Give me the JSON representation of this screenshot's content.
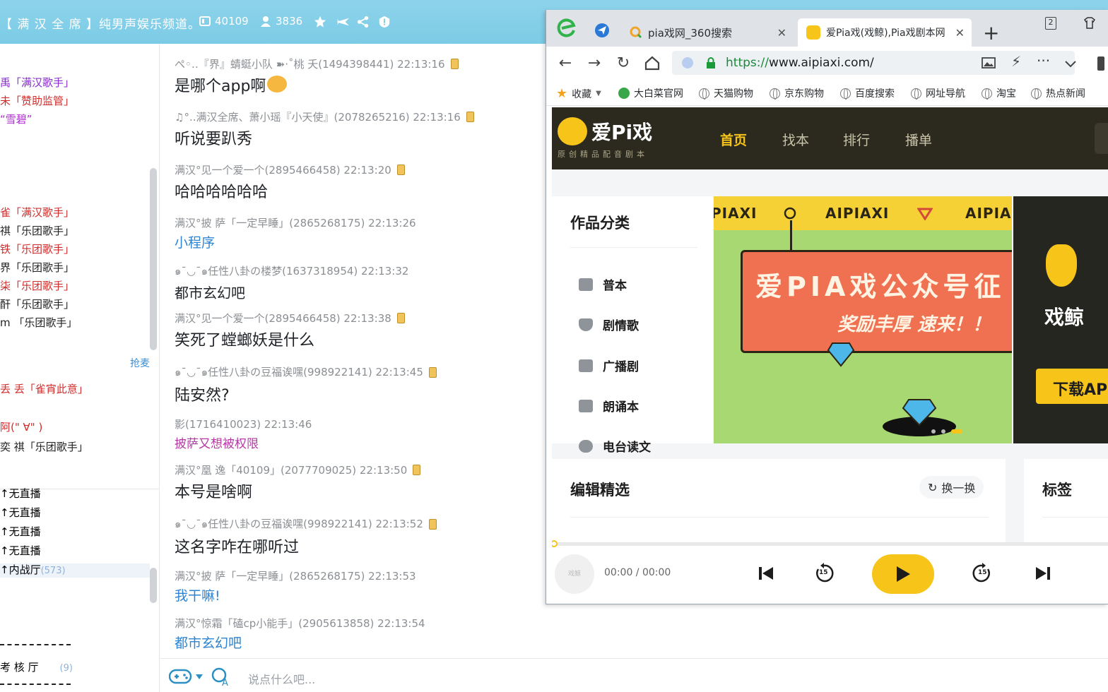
{
  "chat": {
    "title": "【 满 汉 全 席 】纯男声娱乐频道。",
    "room_id": "40109",
    "online_count": "3836",
    "input_placeholder": "说点什么吧...",
    "grab_mic": "抢麦",
    "left_rows_top": [
      {
        "text": "禹「满汉歌手」",
        "color": "#8a2bd1"
      },
      {
        "text": "未「赞助监管」",
        "color": "#d12b2b"
      },
      {
        "text": "“雪碧”",
        "color": "#b02bd1"
      }
    ],
    "left_rows_mid": [
      {
        "text": "雀「满汉歌手」",
        "color": "#d12b2b"
      },
      {
        "text": "祺「乐团歌手」",
        "color": "#222222"
      },
      {
        "text": "铁「乐团歌手」",
        "color": "#d12b2b"
      },
      {
        "text": "界「乐团歌手」",
        "color": "#222222"
      },
      {
        "text": "柒「乐团歌手」",
        "color": "#d12b2b"
      },
      {
        "text": "酐「乐团歌手」",
        "color": "#222222"
      },
      {
        "text": "m 「乐团歌手」",
        "color": "#222222"
      }
    ],
    "left_rows_queue": [
      {
        "text": "丢   丢「雀宵此意」",
        "color": "#d12b2b"
      },
      {
        "text": "阿(\" ∀\" )",
        "color": "#d12b2b"
      },
      {
        "text": "奕   祺「乐团歌手」",
        "color": "#222222"
      }
    ],
    "left_rows_channels": [
      "无直播",
      "无直播",
      "无直播",
      "无直播"
    ],
    "inner_hall": {
      "label": "内战厅",
      "count": "(573)"
    },
    "assess_hall": {
      "label": "考 核 厅",
      "count": "(9)"
    },
    "messages": [
      {
        "meta": "ぺ◦‥『界』蜻蜓小队 ➽·˚桃    夭(1494398441)  22:13:16",
        "text": "是哪个app啊",
        "style": "normal",
        "emoji": true,
        "device": true
      },
      {
        "meta": "♫°..满汉全席、萧小瑶『小天使』(2078265216)  22:13:16",
        "text": "听说要趴秀",
        "style": "normal",
        "device": true
      },
      {
        "meta": "满汉°见一个爱一个(2895466458)  22:13:20",
        "text": "哈哈哈哈哈哈",
        "style": "normal",
        "device": true
      },
      {
        "meta": "满汉°披    萨「一定早睡」(2865268175)  22:13:26",
        "text": "小程序",
        "style": "link"
      },
      {
        "meta": "๑¯◡¯๑任性八卦の楼梦(1637318954)  22:13:32",
        "text": "都市玄幻吧",
        "style": "normal"
      },
      {
        "meta": "满汉°见一个爱一个(2895466458)  22:13:38",
        "text": "笑死了螳螂妖是什么",
        "style": "normal",
        "device": true
      },
      {
        "meta": "๑¯◡¯๑任性八卦の豆福诶嘿(998922141)  22:13:45",
        "text": "陆安然?",
        "style": "normal",
        "device": true
      },
      {
        "meta": "影(1716410023)  22:13:46",
        "text": "披萨又想被权限",
        "style": "magenta"
      },
      {
        "meta": "满汉°凰    逸「40109」(2077709025)  22:13:50",
        "text": "本号是啥啊",
        "style": "normal",
        "device": true
      },
      {
        "meta": "๑¯◡¯๑任性八卦の豆福诶嘿(998922141)  22:13:52",
        "text": "这名字咋在哪听过",
        "style": "normal",
        "device": true
      },
      {
        "meta": "满汉°披    萨「一定早睡」(2865268175)  22:13:53",
        "text": "我干嘛!",
        "style": "link"
      },
      {
        "meta": "满汉°惊霜「磕cp小能手」(2905613858)  22:13:54",
        "text": "都市玄幻吧",
        "style": "link"
      }
    ]
  },
  "browser": {
    "tabs": [
      {
        "label": "pia戏网_360搜索"
      },
      {
        "label": "爱Pia戏(戏鲸),Pia戏剧本网"
      }
    ],
    "tab_count_badge": "2",
    "url_https": "https://",
    "url_rest": "www.aipiaxi.com/",
    "bookmarks": [
      "收藏",
      "大白菜官网",
      "天猫购物",
      "京东购物",
      "百度搜索",
      "网址导航",
      "淘宝",
      "热点新闻"
    ]
  },
  "site": {
    "logo": "爱Pi戏",
    "logo_sub": "原创精品配音剧本",
    "nav": [
      "首页",
      "找本",
      "排行",
      "播单"
    ],
    "categories_title": "作品分类",
    "categories": [
      "普本",
      "剧情歌",
      "广播剧",
      "朗诵本",
      "电台读文"
    ],
    "banner_strip": [
      "PIAXI",
      "AIPIAXI",
      "AIPIA"
    ],
    "banner_headline": "爱PIA戏公众号征",
    "banner_sub": "奖励丰厚   速来！！",
    "app_name": "戏鲸",
    "download": "下载APP",
    "editor_title": "编辑精选",
    "refresh": "换一换",
    "tags_title": "标签",
    "player_cover": "戏鲸",
    "player_time": "00:00 / 00:00",
    "skip_seconds": "15"
  },
  "colors": {
    "accent": "#f7c51a",
    "header_dark": "#2c2a1f",
    "chat_link": "#2d84d2",
    "chat_top": "#8dd3ea"
  }
}
